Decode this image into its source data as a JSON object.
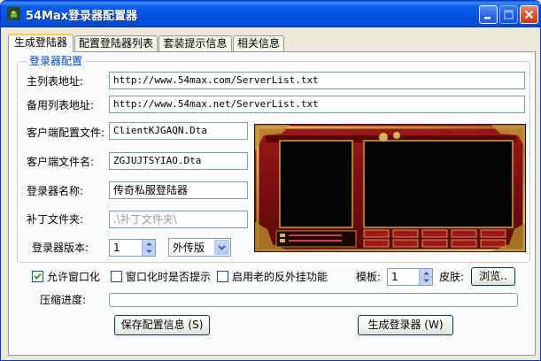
{
  "window": {
    "title": "54Max登录器配置器",
    "accent": "#0054e3"
  },
  "tabs": [
    {
      "label": "生成登陆器",
      "active": true
    },
    {
      "label": "配置登陆器列表",
      "active": false
    },
    {
      "label": "套装提示信息",
      "active": false
    },
    {
      "label": "相关信息",
      "active": false
    }
  ],
  "config": {
    "group_title": "登录器配置",
    "main_list_label": "主列表地址:",
    "main_list_value": "http://www.54max.com/ServerList.txt",
    "backup_list_label": "备用列表地址:",
    "backup_list_value": "http://www.54max.net/ServerList.txt",
    "client_config_label": "客户端配置文件:",
    "client_config_value": "ClientKJGAQN.Dta",
    "client_file_label": "客户端文件名:",
    "client_file_value": "ZGJUJTSYIAO.Dta",
    "launcher_name_label": "登录器名称:",
    "launcher_name_value": "传奇私服登陆器",
    "patch_folder_label": "补丁文件夹:",
    "patch_folder_value": ".\\补丁文件夹\\",
    "version_label": "登录器版本:",
    "version_value": "1",
    "edition_value": "外传版"
  },
  "options": {
    "allow_window": {
      "label": "允许窗口化",
      "checked": true
    },
    "window_prompt": {
      "label": "窗口化时是否提示",
      "checked": false
    },
    "old_anticheat": {
      "label": "启用老的反外挂功能",
      "checked": false
    },
    "template_label": "模板:",
    "template_value": "1",
    "skin_label": "皮肤:",
    "browse_label": "浏览..",
    "progress_label": "压缩进度:",
    "progress": 0
  },
  "buttons": {
    "save_label": "保存配置信息 (S)",
    "generate_label": "生成登录器 (W)"
  }
}
